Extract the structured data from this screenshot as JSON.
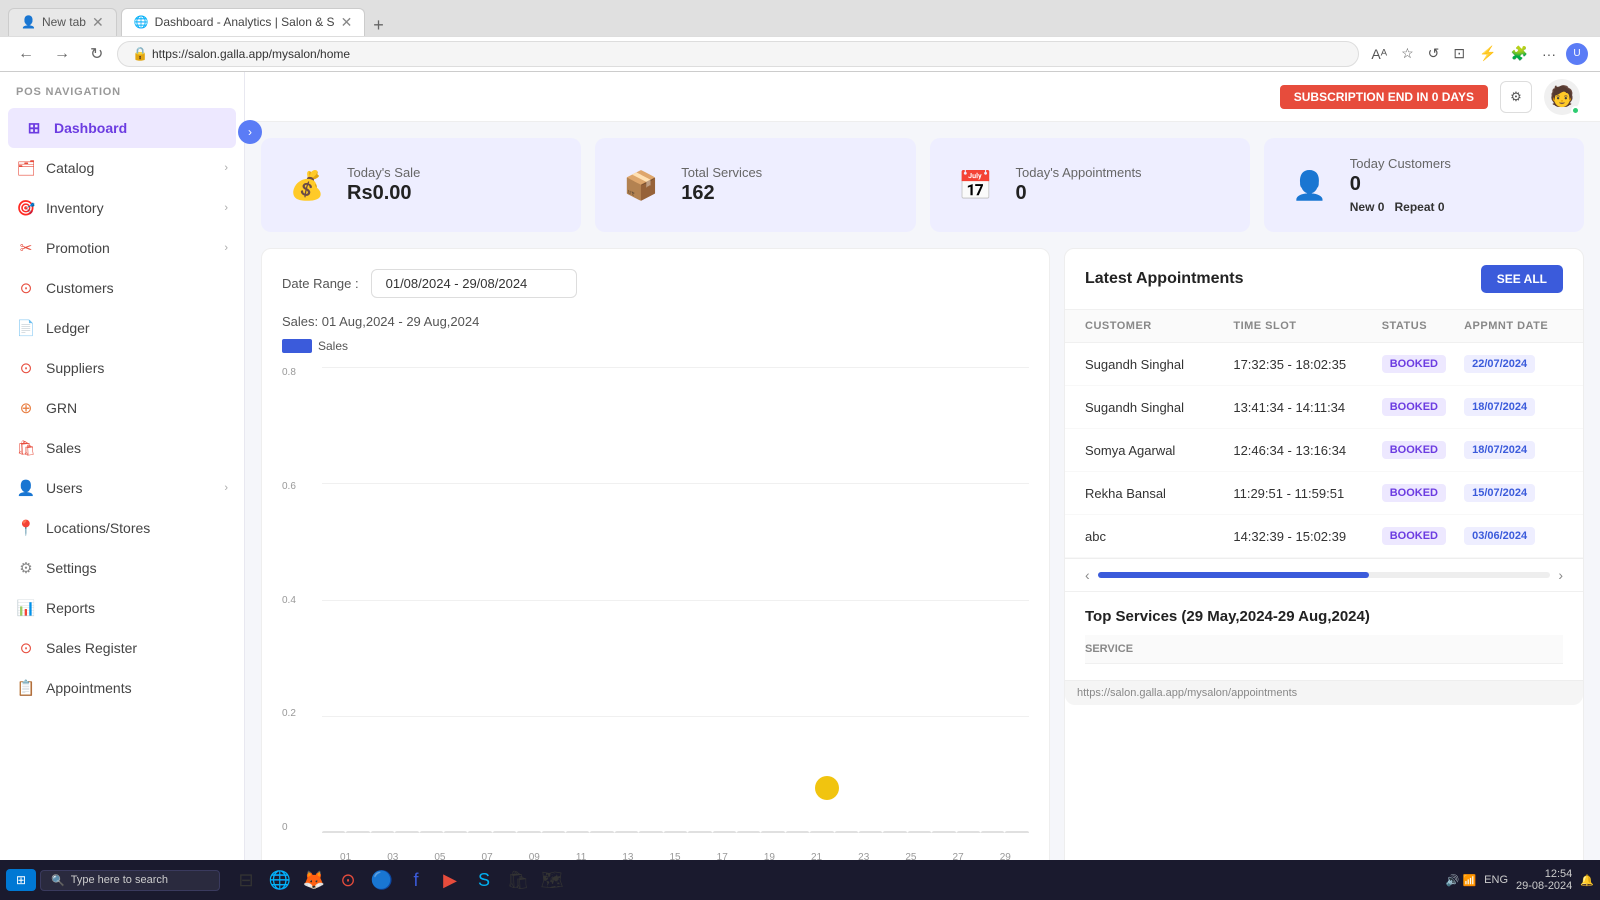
{
  "browser": {
    "url": "https://salon.galla.app/mysalon/home",
    "tabs": [
      {
        "title": "New tab",
        "icon": "",
        "active": false
      },
      {
        "title": "Dashboard - Analytics | Salon & S",
        "icon": "🌐",
        "active": true
      }
    ]
  },
  "header": {
    "subscription_badge": "SUBSCRIPTION END IN 0 DAYS",
    "settings_label": "⚙"
  },
  "sidebar": {
    "header": "POS NAVIGATION",
    "items": [
      {
        "label": "Dashboard",
        "icon": "⊞",
        "active": true,
        "has_arrow": false
      },
      {
        "label": "Catalog",
        "icon": "🗂",
        "active": false,
        "has_arrow": true
      },
      {
        "label": "Inventory",
        "icon": "🎯",
        "active": false,
        "has_arrow": true
      },
      {
        "label": "Promotion",
        "icon": "✂",
        "active": false,
        "has_arrow": true
      },
      {
        "label": "Customers",
        "icon": "⊙",
        "active": false,
        "has_arrow": false
      },
      {
        "label": "Ledger",
        "icon": "📄",
        "active": false,
        "has_arrow": false
      },
      {
        "label": "Suppliers",
        "icon": "⊙",
        "active": false,
        "has_arrow": false
      },
      {
        "label": "GRN",
        "icon": "⊕",
        "active": false,
        "has_arrow": false
      },
      {
        "label": "Sales",
        "icon": "🛍",
        "active": false,
        "has_arrow": false
      },
      {
        "label": "Users",
        "icon": "👤",
        "active": false,
        "has_arrow": true
      },
      {
        "label": "Locations/Stores",
        "icon": "📍",
        "active": false,
        "has_arrow": false
      },
      {
        "label": "Settings",
        "icon": "⚙",
        "active": false,
        "has_arrow": false
      },
      {
        "label": "Reports",
        "icon": "📊",
        "active": false,
        "has_arrow": false
      },
      {
        "label": "Sales Register",
        "icon": "⊙",
        "active": false,
        "has_arrow": false
      },
      {
        "label": "Appointments",
        "icon": "📋",
        "active": false,
        "has_arrow": false
      }
    ]
  },
  "stats": [
    {
      "label": "Today's Sale",
      "value": "Rs0.00",
      "icon": "💰",
      "icon_color": "#e74c3c"
    },
    {
      "label": "Total Services",
      "value": "162",
      "icon": "📦",
      "icon_color": "#e87c3e"
    },
    {
      "label": "Today's Appointments",
      "value": "0",
      "icon": "📅",
      "icon_color": "#e87c3e"
    },
    {
      "label": "Today Customers",
      "value": "0",
      "new_label": "New",
      "new_value": "0",
      "repeat_label": "Repeat",
      "repeat_value": "0",
      "icon": "👤",
      "icon_color": "#e87c3e"
    }
  ],
  "chart": {
    "title": "Sales: 01 Aug,2024 - 29 Aug,2024",
    "date_range_label": "Date Range :",
    "date_range_value": "01/08/2024 - 29/08/2024",
    "legend_label": "Sales",
    "bars": [
      0,
      0,
      0,
      0,
      0,
      0,
      0,
      0,
      0,
      0,
      0,
      0,
      0,
      0,
      0,
      0,
      0,
      0,
      0,
      0,
      0,
      0,
      0,
      0,
      0,
      0,
      0,
      0,
      0
    ],
    "x_labels": [
      "01",
      "03",
      "05",
      "07",
      "09",
      "11",
      "13",
      "15",
      "17",
      "19",
      "21",
      "23",
      "25",
      "27",
      "29"
    ],
    "y_labels": [
      "0.8",
      "0.6",
      "0.4",
      "0.2",
      "0"
    ]
  },
  "appointments": {
    "title": "Latest Appointments",
    "see_all_label": "SEE ALL",
    "columns": [
      "CUSTOMER",
      "TIME SLOT",
      "STATUS",
      "APPMNT DATE"
    ],
    "rows": [
      {
        "customer": "Sugandh Singhal",
        "time_slot": "17:32:35 - 18:02:35",
        "status": "BOOKED",
        "date": "22/07/2024"
      },
      {
        "customer": "Sugandh Singhal",
        "time_slot": "13:41:34 - 14:11:34",
        "status": "BOOKED",
        "date": "18/07/2024"
      },
      {
        "customer": "Somya Agarwal",
        "time_slot": "12:46:34 - 13:16:34",
        "status": "BOOKED",
        "date": "18/07/2024"
      },
      {
        "customer": "Rekha Bansal",
        "time_slot": "11:29:51 - 11:59:51",
        "status": "BOOKED",
        "date": "15/07/2024"
      },
      {
        "customer": "abc",
        "time_slot": "14:32:39 - 15:02:39",
        "status": "BOOKED",
        "date": "03/06/2024"
      }
    ]
  },
  "top_services": {
    "title": "Top Services (29 May,2024-29 Aug,2024)",
    "column": "SERVICE"
  },
  "taskbar": {
    "time": "12:54",
    "date": "29-08-2024",
    "search_placeholder": "Type here to search",
    "lang": "ENG"
  },
  "url_hint": "https://salon.galla.app/mysalon/appointments"
}
